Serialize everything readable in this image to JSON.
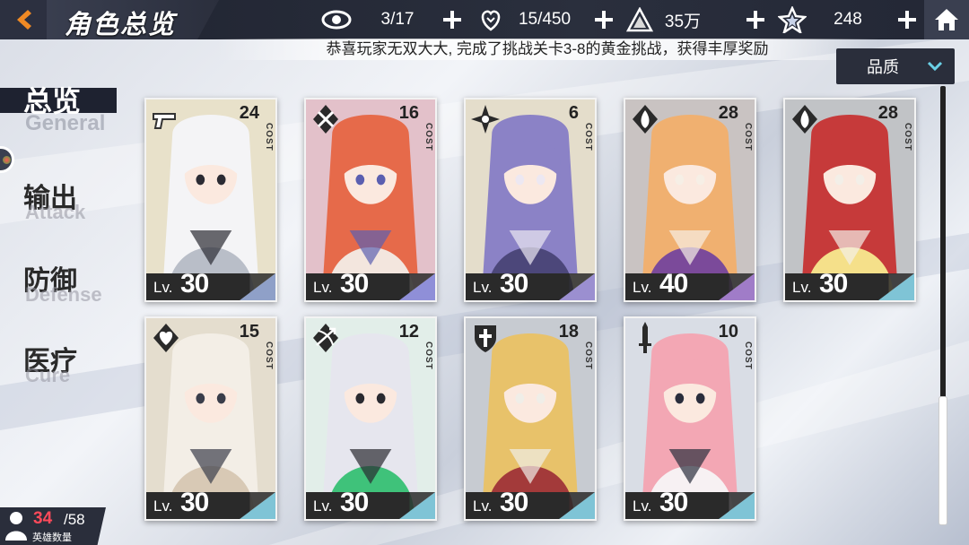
{
  "header": {
    "title": "角色总览",
    "resources": [
      {
        "icon": "eye-icon",
        "value": "3/17"
      },
      {
        "icon": "heart-hand-icon",
        "value": "15/450"
      },
      {
        "icon": "crystal-triangle-icon",
        "value": "35万"
      },
      {
        "icon": "star-badge-icon",
        "value": "248"
      }
    ]
  },
  "marquee": "恭喜玩家无双大大, 完成了挑战关卡3-8的黄金挑战，获得丰厚奖励",
  "sort": {
    "label": "品质"
  },
  "nav": [
    {
      "cn": "总览",
      "en": "General",
      "active": true
    },
    {
      "cn": "输出",
      "en": "Attack",
      "active": false
    },
    {
      "cn": "防御",
      "en": "Defense",
      "active": false
    },
    {
      "cn": "医疗",
      "en": "Cure",
      "active": false
    }
  ],
  "cost_label": "COST",
  "lv_label": "Lv.",
  "cards": [
    {
      "cost": "24",
      "level": "30",
      "class_icon": "pistol-icon",
      "colors": [
        "#f4f4f6",
        "#b9bec8",
        "#2b2b33",
        "#d8b24a"
      ],
      "tri": "#8fa0c8"
    },
    {
      "cost": "16",
      "level": "30",
      "class_icon": "crossed-swords-icon",
      "colors": [
        "#e66a4a",
        "#f3e6de",
        "#5b5fb0",
        "#c4354a"
      ],
      "tri": "#8f8fd8"
    },
    {
      "cost": "6",
      "level": "30",
      "class_icon": "shuriken-icon",
      "colors": [
        "#8b82c6",
        "#4c477a",
        "#ede8f2",
        "#c9a24e"
      ],
      "tri": "#9b8fd0"
    },
    {
      "cost": "28",
      "level": "40",
      "class_icon": "flame-icon",
      "colors": [
        "#f0b070",
        "#7b4a9a",
        "#f6efe6",
        "#5a3a2a"
      ],
      "tri": "#a07cc8"
    },
    {
      "cost": "28",
      "level": "30",
      "class_icon": "flame-icon",
      "colors": [
        "#c63a3a",
        "#f5e08a",
        "#f3efe8",
        "#3a3a3a"
      ],
      "tri": "#7fc4d6"
    },
    {
      "cost": "15",
      "level": "30",
      "class_icon": "heart-wings-icon",
      "colors": [
        "#f3eee6",
        "#d8c9b5",
        "#3a3d4a",
        "#c9a35a"
      ],
      "tri": "#7fc4d6"
    },
    {
      "cost": "12",
      "level": "30",
      "class_icon": "bow-arrow-icon",
      "colors": [
        "#e6e6ee",
        "#3fc27a",
        "#2a2a30",
        "#bfe6c9"
      ],
      "tri": "#7fc4d6"
    },
    {
      "cost": "18",
      "level": "30",
      "class_icon": "cross-shield-icon",
      "colors": [
        "#e8c26a",
        "#a33a3a",
        "#f0eee8",
        "#555a66"
      ],
      "tri": "#7fc4d6"
    },
    {
      "cost": "10",
      "level": "30",
      "class_icon": "dagger-icon",
      "colors": [
        "#f3a7b4",
        "#f7f1f3",
        "#2a2d3c",
        "#9aa2b8"
      ],
      "tri": "#7fc4d6"
    }
  ],
  "hero_count": {
    "current": "34",
    "max": "/58",
    "label": "英雄数量"
  }
}
